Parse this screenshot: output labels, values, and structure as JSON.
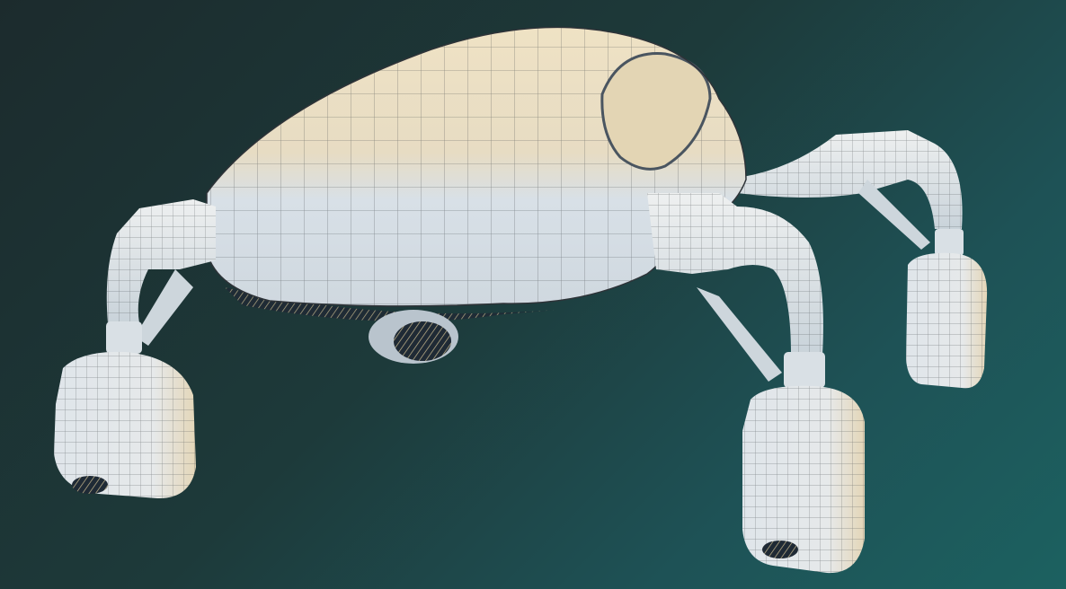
{
  "scene": {
    "subject": "",
    "colors": {
      "background_dark": "#1c2b2d",
      "background_light": "#1c6160",
      "shell_top": "#e9dcbf",
      "shell_bottom": "#d2dde6",
      "wire": "#3b3f44",
      "shadow": "#1f2a35"
    }
  }
}
